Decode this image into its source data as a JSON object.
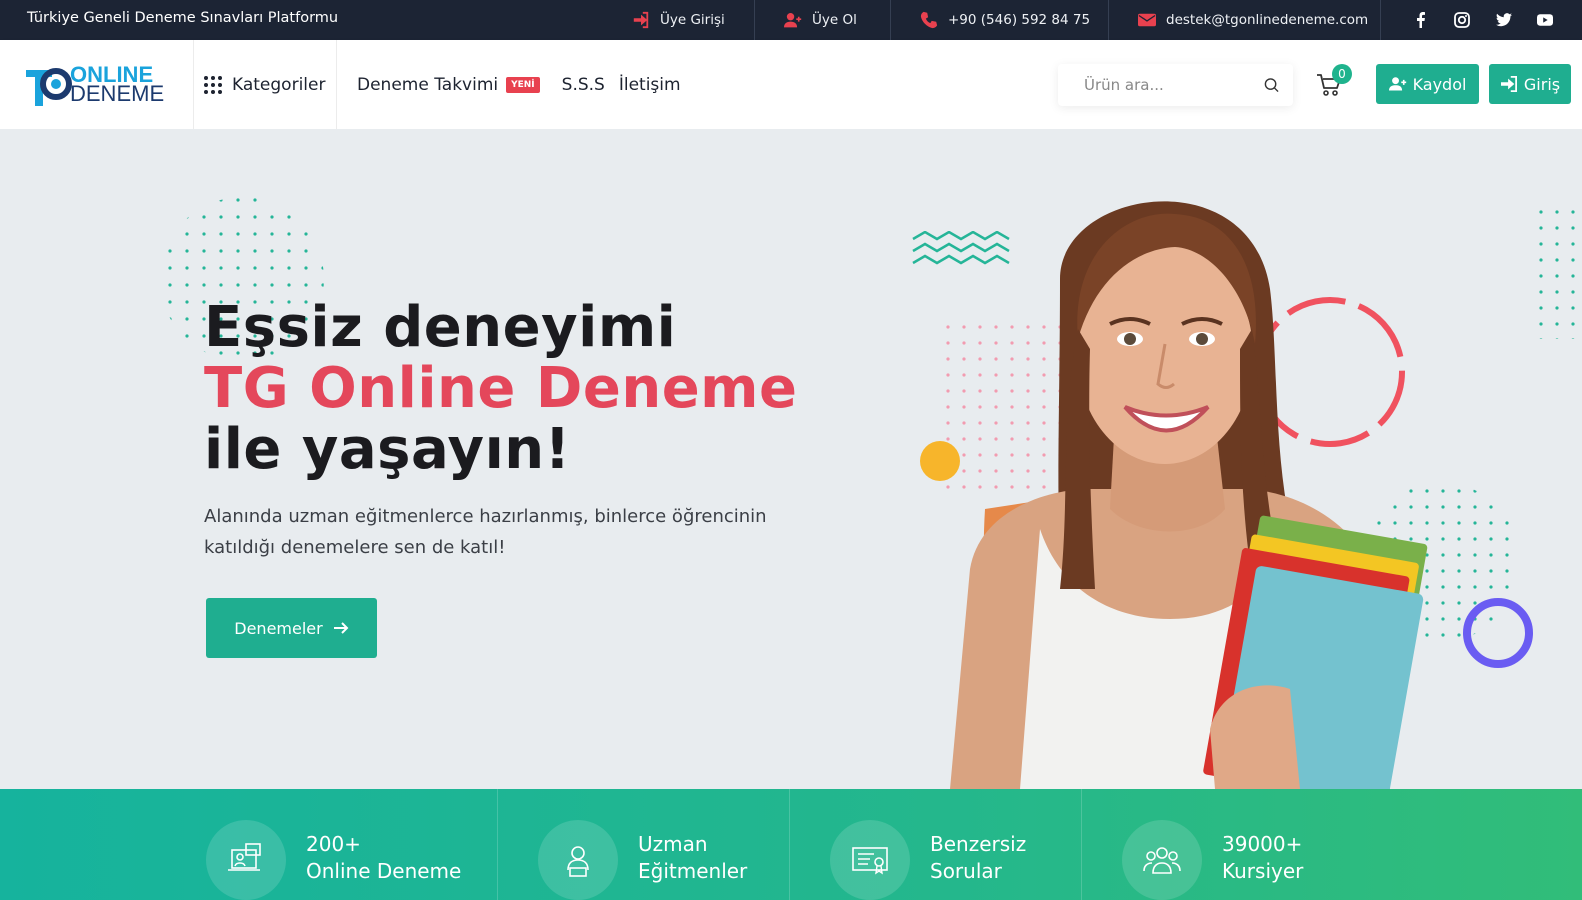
{
  "topbar": {
    "tagline": "Türkiye Geneli Deneme Sınavları Platformu",
    "login": "Üye Girişi",
    "register": "Üye Ol",
    "phone": "+90 (546) 592 84 75",
    "email": "destek@tgonlinedeneme.com",
    "social": [
      "facebook-icon",
      "instagram-icon",
      "twitter-icon",
      "youtube-icon"
    ]
  },
  "logo": {
    "mark": "TG",
    "line1": "ONLINE",
    "line2": "DENEME"
  },
  "header": {
    "categories": "Kategoriler",
    "nav": [
      {
        "label": "Deneme Takvimi",
        "badge": "YENİ"
      },
      {
        "label": "S.S.S"
      },
      {
        "label": "İletişim"
      }
    ],
    "search_placeholder": "Ürün ara...",
    "cart_count": "0",
    "signup": "Kaydol",
    "signin": "Giriş"
  },
  "hero": {
    "line1": "Eşsiz deneyimi",
    "line2": "TG Online Deneme",
    "line3": "ile yaşayın!",
    "subtitle": "Alanında uzman eğitmenlerce hazırlanmış, binlerce öğrencinin katıldığı denemelere sen de katıl!",
    "cta": "Denemeler"
  },
  "stats": [
    {
      "line1": "200+",
      "line2": "Online Deneme",
      "icon": "laptop-exam-icon"
    },
    {
      "line1": "Uzman",
      "line2": "Eğitmenler",
      "icon": "instructor-icon"
    },
    {
      "line1": "Benzersiz",
      "line2": "Sorular",
      "icon": "certificate-icon"
    },
    {
      "line1": "39000+",
      "line2": "Kursiyer",
      "icon": "students-icon"
    }
  ],
  "colors": {
    "accent": "#1fae90",
    "highlight": "#e4475b",
    "topbar": "#1c2434",
    "icon_red": "#e8414f"
  }
}
